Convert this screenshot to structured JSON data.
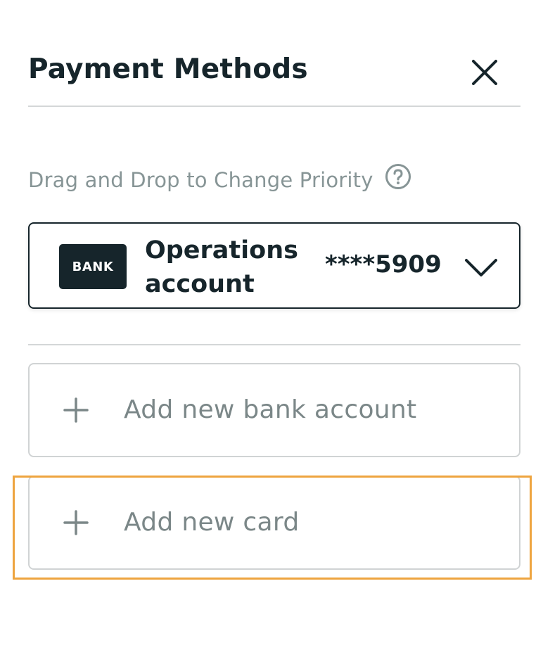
{
  "header": {
    "title": "Payment Methods",
    "close_icon": "close-icon"
  },
  "hint": {
    "text": "Drag and Drop to Change Priority",
    "icon": "help-circle-icon"
  },
  "accounts": [
    {
      "logo_text": "BANK",
      "name": "Operations account",
      "masked_number": "****5909",
      "expand_icon": "chevron-down-icon"
    }
  ],
  "actions": {
    "add_bank_account": {
      "label": "Add new bank account",
      "icon": "plus-icon"
    },
    "add_card": {
      "label": "Add new card",
      "icon": "plus-icon"
    }
  },
  "colors": {
    "text_primary": "#16252b",
    "text_muted": "#879596",
    "divider": "#d4d7d8",
    "highlight": "#eea43f"
  }
}
